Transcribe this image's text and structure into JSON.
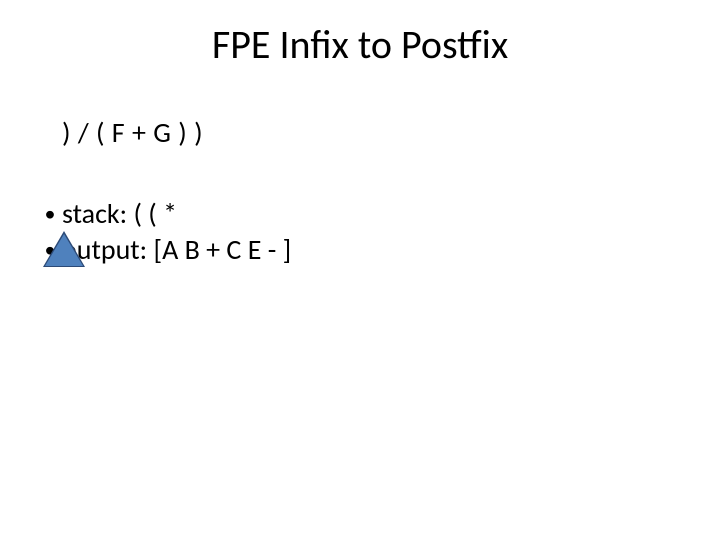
{
  "title": "FPE Infix to Postfix",
  "expression": ") / ( F + G ) )",
  "bullets": {
    "stack_label": "stack: ( ( *",
    "output_label": "output: [A B + C E - ]"
  },
  "shapes": {
    "triangle": "triangle-marker"
  }
}
